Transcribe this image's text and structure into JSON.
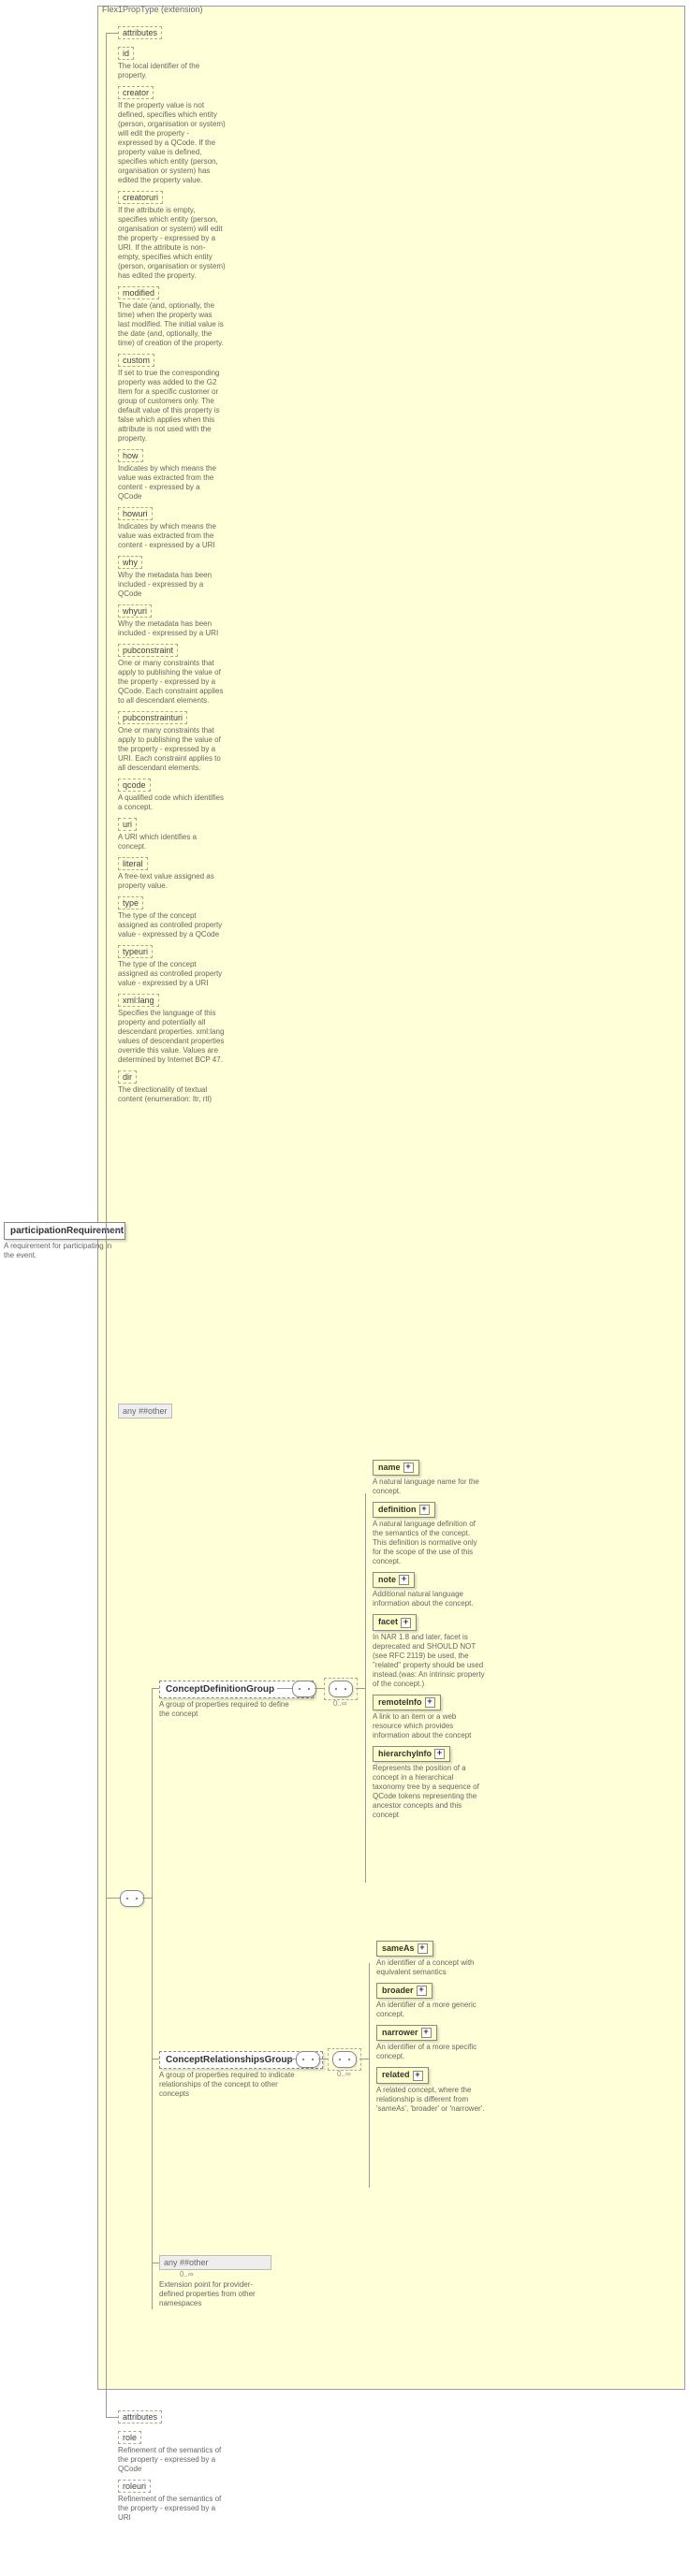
{
  "extension": {
    "label": "Flex1PropType (extension)"
  },
  "root": {
    "name": "participationRequirement",
    "desc": "A requirement for participating in the event."
  },
  "attributes_label": "attributes",
  "attrs_main": [
    {
      "name": "id",
      "desc": "The local identifier of the property."
    },
    {
      "name": "creator",
      "desc": "If the property value is not defined, specifies which entity (person, organisation or system) will edit the property - expressed by a QCode. If the property value is defined, specifies which entity (person, organisation or system) has edited the property value."
    },
    {
      "name": "creatoruri",
      "desc": "If the attribute is empty, specifies which entity (person, organisation or system) will edit the property - expressed by a URI. If the attribute is non-empty, specifies which entity (person, organisation or system) has edited the property."
    },
    {
      "name": "modified",
      "desc": "The date (and, optionally, the time) when the property was last modified. The initial value is the date (and, optionally, the time) of creation of the property."
    },
    {
      "name": "custom",
      "desc": "If set to true the corresponding property was added to the G2 Item for a specific customer or group of customers only. The default value of this property is false which applies when this attribute is not used with the property."
    },
    {
      "name": "how",
      "desc": "Indicates by which means the value was extracted from the content - expressed by a QCode"
    },
    {
      "name": "howuri",
      "desc": "Indicates by which means the value was extracted from the content - expressed by a URI"
    },
    {
      "name": "why",
      "desc": "Why the metadata has been included - expressed by a QCode"
    },
    {
      "name": "whyuri",
      "desc": "Why the metadata has been included - expressed by a URI"
    },
    {
      "name": "pubconstraint",
      "desc": "One or many constraints that apply to publishing the value of the property - expressed by a QCode. Each constraint applies to all descendant elements."
    },
    {
      "name": "pubconstrainturi",
      "desc": "One or many constraints that apply to publishing the value of the property - expressed by a URI. Each constraint applies to all descendant elements."
    },
    {
      "name": "qcode",
      "desc": "A qualified code which identifies a concept."
    },
    {
      "name": "uri",
      "desc": "A URI which identifies a concept."
    },
    {
      "name": "literal",
      "desc": "A free-text value assigned as property value."
    },
    {
      "name": "type",
      "desc": "The type of the concept assigned as controlled property value - expressed by a QCode"
    },
    {
      "name": "typeuri",
      "desc": "The type of the concept assigned as controlled property value - expressed by a URI"
    },
    {
      "name": "xml:lang",
      "desc": "Specifies the language of this property and potentially all descendant properties. xml:lang values of descendant properties override this value. Values are determined by Internet BCP 47."
    },
    {
      "name": "dir",
      "desc": "The directionality of textual content (enumeration: ltr, rtl)"
    }
  ],
  "any_other": "any ##other",
  "conceptDef": {
    "name": "ConceptDefinitionGroup",
    "desc": "A group of properties required to define the concept",
    "children": [
      {
        "name": "name",
        "desc": "A natural language name for the concept."
      },
      {
        "name": "definition",
        "desc": "A natural language definition of the semantics of the concept. This definition is normative only for the scope of the use of this concept."
      },
      {
        "name": "note",
        "desc": "Additional natural language information about the concept."
      },
      {
        "name": "facet",
        "desc": "In NAR 1.8 and later, facet is deprecated and SHOULD NOT (see RFC 2119) be used, the \"related\" property should be used instead.(was: An intrinsic property of the concept.)"
      },
      {
        "name": "remoteInfo",
        "desc": "A link to an item or a web resource which provides information about the concept"
      },
      {
        "name": "hierarchyInfo",
        "desc": "Represents the position of a concept in a hierarchical taxonomy tree by a sequence of QCode tokens representing the ancestor concepts and this concept"
      }
    ]
  },
  "conceptRel": {
    "name": "ConceptRelationshipsGroup",
    "desc": "A group of properties required to indicate relationships of the concept to other concepts",
    "children": [
      {
        "name": "sameAs",
        "desc": "An identifier of a concept with equivalent semantics"
      },
      {
        "name": "broader",
        "desc": "An identifier of a more generic concept."
      },
      {
        "name": "narrower",
        "desc": "An identifier of a more specific concept."
      },
      {
        "name": "related",
        "desc": "A related concept, where the relationship is different from 'sameAs', 'broader' or 'narrower'."
      }
    ]
  },
  "any_ext": {
    "label": "any ##other",
    "occ": "0..∞",
    "desc": "Extension point for provider-defined properties from other namespaces"
  },
  "attrs_bottom": [
    {
      "name": "role",
      "desc": "Refinement of the semantics of the property - expressed by a QCode"
    },
    {
      "name": "roleuri",
      "desc": "Refinement of the semantics of the property - expressed by a URI"
    }
  ],
  "occ_label": "0..∞"
}
